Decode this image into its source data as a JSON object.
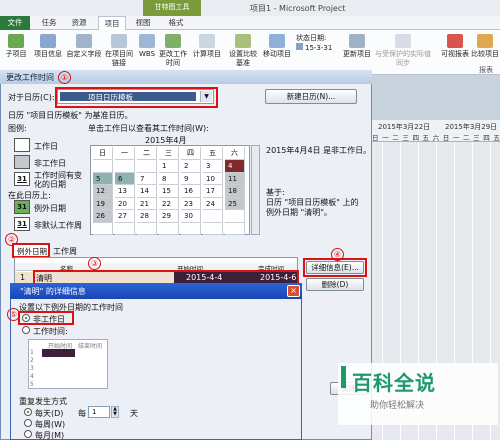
{
  "app": {
    "title": "项目1 - Microsoft Project",
    "context_tab": "甘特图工具"
  },
  "tabs": [
    "文件",
    "任务",
    "资源",
    "项目",
    "视图",
    "格式"
  ],
  "ribbon": [
    {
      "label": "子项目"
    },
    {
      "label": "项目信息"
    },
    {
      "label": "自定义字段"
    },
    {
      "label": "在项目间链接"
    },
    {
      "label": "WBS"
    },
    {
      "label": "更改工作时间"
    },
    {
      "label": "计算项目"
    },
    {
      "label": "设置比较基准"
    },
    {
      "label": "移动项目"
    },
    {
      "label": "状态日期:"
    },
    {
      "label": "15-3-31"
    },
    {
      "label": "更新项目"
    },
    {
      "label": "与受保护的实际值同步"
    },
    {
      "label": "可视报表"
    },
    {
      "label": "比较项目"
    },
    {
      "label": "报表"
    }
  ],
  "gantt": {
    "dates": [
      "2015年3月22日",
      "2015年3月29日"
    ],
    "days": [
      "日",
      "一",
      "二",
      "三",
      "四",
      "五",
      "六",
      "日",
      "一",
      "二",
      "三",
      "四",
      "五"
    ]
  },
  "main_dialog": {
    "title": "更改工作时间",
    "for_calendar_label": "对于日历(C):",
    "calendar_value": "项目日历模板",
    "new_calendar_button": "新建日历(N)...",
    "base_text": "日历 \"项目日历模板\" 为基准日历。",
    "legend_title": "图例:",
    "legend": [
      {
        "box": "",
        "label": "工作日"
      },
      {
        "box": "",
        "label": "非工作日"
      },
      {
        "box": "31",
        "label": "工作时间有变化的日期"
      }
    ],
    "legend_on_calendar": "在此日历上:",
    "legend2": [
      {
        "box": "31",
        "label": "例外日期"
      },
      {
        "box": "31",
        "label": "非默认工作周"
      }
    ],
    "click_hint": "单击工作日以查看其工作时间(W):",
    "month": "2015年4月",
    "weekdays": [
      "日",
      "一",
      "二",
      "三",
      "四",
      "五",
      "六"
    ],
    "weeks": [
      [
        "",
        "",
        "",
        "1",
        "2",
        "3",
        "4"
      ],
      [
        "5",
        "6",
        "7",
        "8",
        "9",
        "10",
        "11"
      ],
      [
        "12",
        "13",
        "14",
        "15",
        "16",
        "17",
        "18"
      ],
      [
        "19",
        "20",
        "21",
        "22",
        "23",
        "24",
        "25"
      ],
      [
        "26",
        "27",
        "28",
        "29",
        "30",
        "",
        ""
      ],
      [
        "",
        "",
        "",
        "",
        "",
        "",
        ""
      ]
    ],
    "right_info": "2015年4月4日 是非工作日。",
    "based_on_label": "基于:",
    "based_on_text": "日历 \"项目日历模板\" 上的例外日期 \"清明\"。",
    "tab_exceptions": "例外日期",
    "tab_workweek": "工作周",
    "columns": [
      "名称",
      "开始时间",
      "完成时间"
    ],
    "row": {
      "num": "1",
      "name": "清明",
      "start": "2015-4-4",
      "end": "2015-4-6"
    },
    "details_button": "详细信息(E)...",
    "delete_button": "删除(D)",
    "close_button": "关闭"
  },
  "annotations": [
    "①",
    "②",
    "③",
    "④",
    "⑤"
  ],
  "details_dialog": {
    "title": "\"清明\" 的详细信息",
    "set_label": "设置以下例外日期的工作时间",
    "opt_nonworking": "非工作日",
    "opt_working": "工作时间:",
    "table_cols": [
      "开始时间",
      "结束时间"
    ],
    "row_nums": [
      "1",
      "2",
      "3",
      "4",
      "5"
    ],
    "recur_label": "重复发生方式",
    "recur": [
      {
        "label": "每天(D)"
      },
      {
        "label": "每周(W)"
      },
      {
        "label": "每月(M)"
      }
    ],
    "every_label": "每",
    "every_value": "1",
    "day_unit": "天"
  },
  "watermark": {
    "title": "百科全说",
    "sub": "助你轻松解决"
  }
}
